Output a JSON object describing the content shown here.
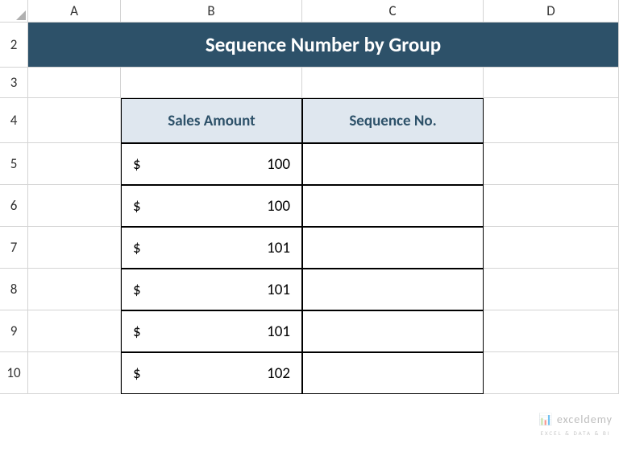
{
  "columns": [
    "A",
    "B",
    "C",
    "D"
  ],
  "rows": [
    "2",
    "3",
    "4",
    "5",
    "6",
    "7",
    "8",
    "9",
    "10"
  ],
  "title": "Sequence Number by Group",
  "table": {
    "headers": [
      "Sales Amount",
      "Sequence No."
    ],
    "currency_symbol": "$",
    "data": [
      {
        "amount": "100",
        "sequence": ""
      },
      {
        "amount": "100",
        "sequence": ""
      },
      {
        "amount": "101",
        "sequence": ""
      },
      {
        "amount": "101",
        "sequence": ""
      },
      {
        "amount": "101",
        "sequence": ""
      },
      {
        "amount": "102",
        "sequence": ""
      }
    ]
  },
  "watermark": {
    "brand": "exceldemy",
    "tagline": "EXCEL & DATA & BI"
  }
}
